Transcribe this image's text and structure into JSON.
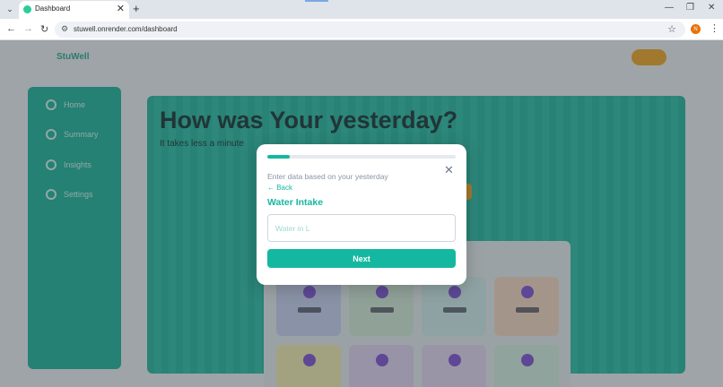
{
  "browser": {
    "tab_title": "Dashboard",
    "tab_menu_icon": "⌄",
    "tab_close_icon": "✕",
    "new_tab_icon": "+",
    "minimize_icon": "—",
    "restore_icon": "❐",
    "close_window_icon": "✕",
    "back_icon": "←",
    "forward_icon": "→",
    "reload_icon": "↻",
    "site_info_icon": "⚙",
    "url": "stuwell.onrender.com/dashboard",
    "bookmark_icon": "☆",
    "profile_initial": "N",
    "menu_icon": "⋮"
  },
  "page": {
    "logo": "StuWell",
    "sidebar_items": [
      "Home",
      "Summary",
      "Insights",
      "Settings"
    ],
    "hero_title": "How was Your yesterday?",
    "hero_subtitle": "It takes less a minute",
    "cards": [
      {
        "color": "#c8d4f4"
      },
      {
        "color": "#d6eedb"
      },
      {
        "color": "#d3f0ee"
      },
      {
        "color": "#f9d9c3"
      },
      {
        "color": "#f6f0b0"
      },
      {
        "color": "#e3d6f6"
      },
      {
        "color": "#e6d9f6"
      },
      {
        "color": "#d6f2e2"
      }
    ]
  },
  "modal": {
    "progress_percent": 12,
    "close_icon": "✕",
    "prompt": "Enter data based on your yesterday",
    "back_label": "← Back",
    "field_title": "Water Intake",
    "input_placeholder": "Water in L",
    "input_value": "",
    "next_label": "Next"
  },
  "colors": {
    "accent": "#14b8a0",
    "orange": "#f2a71b"
  }
}
